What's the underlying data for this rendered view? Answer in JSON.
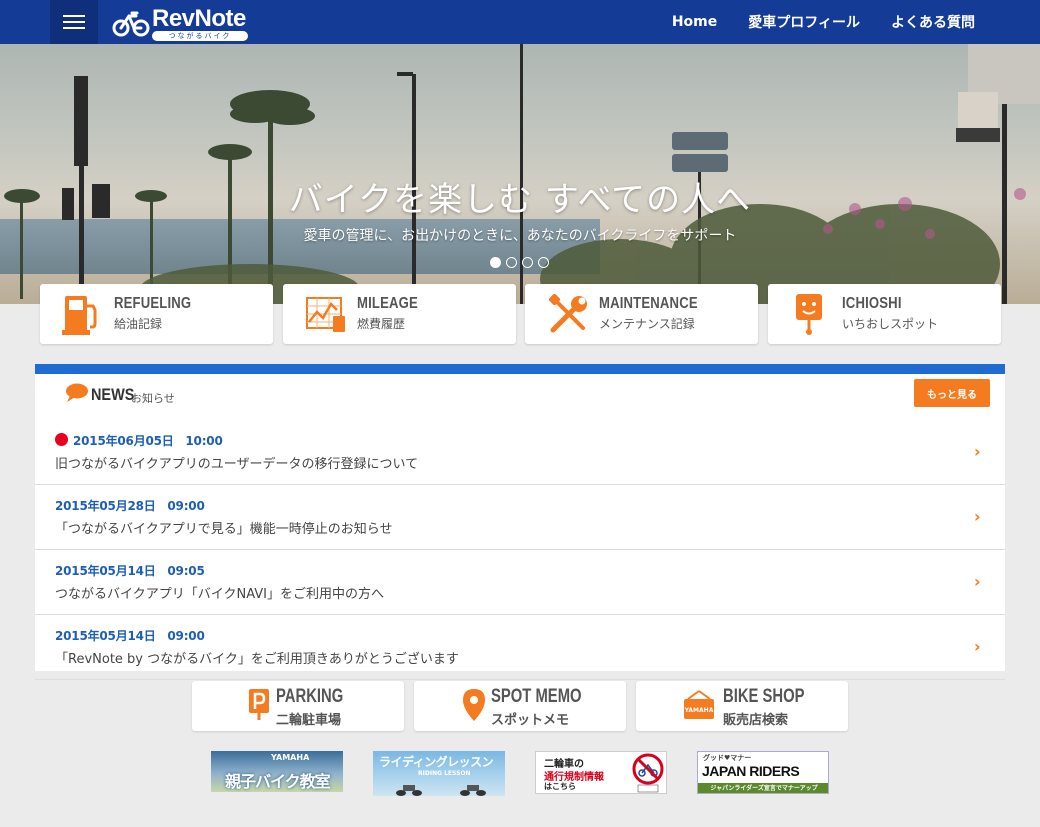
{
  "header": {
    "logo_text": "RevNote",
    "logo_sub": "つながるバイク",
    "nav": [
      "Home",
      "愛車プロフィール",
      "よくある質問"
    ]
  },
  "hero": {
    "title": "バイクを楽しむ すべての人へ",
    "subtitle": "愛車の管理に、お出かけのときに、あなたのバイクライフをサポート",
    "slide_count": 4,
    "active_slide": 1
  },
  "features": [
    {
      "en": "REFUELING",
      "ja": "給油記録",
      "icon": "fuel-pump-icon"
    },
    {
      "en": "MILEAGE",
      "ja": "燃費履歴",
      "icon": "mileage-chart-icon"
    },
    {
      "en": "MAINTENANCE",
      "ja": "メンテナンス記録",
      "icon": "wrench-screwdriver-icon"
    },
    {
      "en": "ICHIOSHI",
      "ja": "いちおしスポット",
      "icon": "spot-pin-icon"
    }
  ],
  "news": {
    "title_en": "NEWS",
    "title_ja": "お知らせ",
    "more_label": "もっと見る",
    "items": [
      {
        "date": "2015年06月05日　10:00",
        "text": "旧つながるバイクアプリのユーザーデータの移行登録について",
        "new": true
      },
      {
        "date": "2015年05月28日　09:00",
        "text": "「つながるバイクアプリで見る」機能一時停止のお知らせ",
        "new": false
      },
      {
        "date": "2015年05月14日　09:05",
        "text": "つながるバイクアプリ「バイクNAVI」をご利用中の方へ",
        "new": false
      },
      {
        "date": "2015年05月14日　09:00",
        "text": "「RevNote by つながるバイク」をご利用頂きありがとうございます",
        "new": false
      }
    ]
  },
  "tools": [
    {
      "en": "PARKING",
      "ja": "二輪駐車場",
      "icon": "parking-icon"
    },
    {
      "en": "SPOT MEMO",
      "ja": "スポットメモ",
      "icon": "location-pin-icon"
    },
    {
      "en": "BIKE SHOP",
      "ja": "販売店検索",
      "icon": "shop-sign-icon"
    }
  ],
  "banners": {
    "b1_top": "YAMAHA",
    "b1_main": "親子バイク教室",
    "b2_main": "ライディングレッスン",
    "b2_sub": "RIDING LESSON",
    "b3_line1": "二輪車の",
    "b3_line2": "通行規制情報",
    "b3_line3": "はこちら",
    "b4_top": "グッド♥マナー",
    "b4_main": "JAPAN RIDERS",
    "b4_sub": "ジャパンライダーズ宣言でマナーアップ"
  },
  "colors": {
    "header": "#143c96",
    "accent": "#f47b20",
    "news_bar": "#1e6bd1",
    "date": "#1e5fb4",
    "new_dot": "#e8001c"
  }
}
